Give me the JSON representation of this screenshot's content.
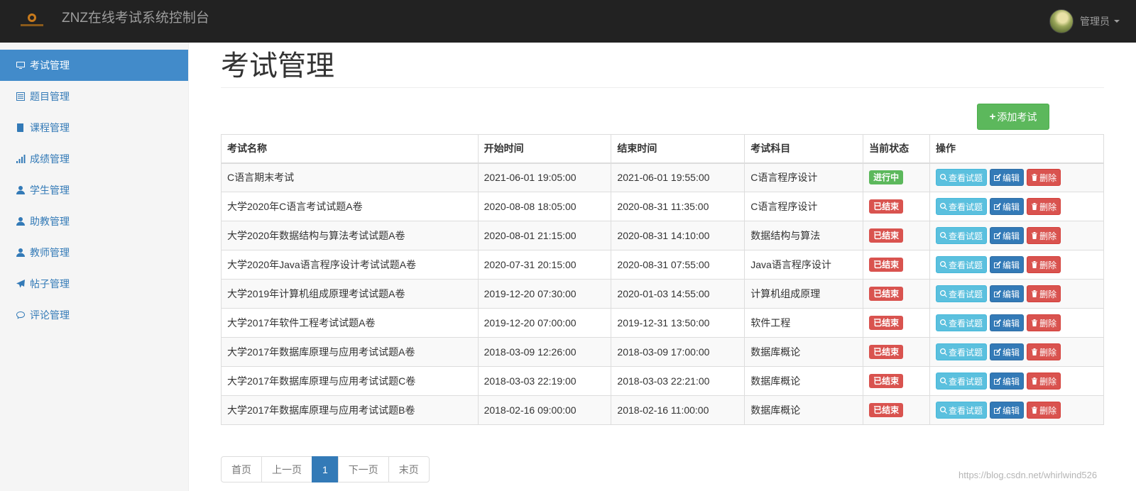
{
  "header": {
    "title": "ZNZ在线考试系统控制台",
    "user_name": "管理员"
  },
  "sidebar": {
    "items": [
      {
        "label": "考试管理",
        "icon": "monitor-icon",
        "active": true
      },
      {
        "label": "题目管理",
        "icon": "list-icon"
      },
      {
        "label": "课程管理",
        "icon": "book-icon"
      },
      {
        "label": "成绩管理",
        "icon": "signal-icon"
      },
      {
        "label": "学生管理",
        "icon": "user-icon"
      },
      {
        "label": "助教管理",
        "icon": "user-icon"
      },
      {
        "label": "教师管理",
        "icon": "user-icon"
      },
      {
        "label": "帖子管理",
        "icon": "send-icon"
      },
      {
        "label": "评论管理",
        "icon": "comment-icon"
      }
    ]
  },
  "main": {
    "title": "考试管理",
    "add_button": "添加考试",
    "table": {
      "headers": [
        "考试名称",
        "开始时间",
        "结束时间",
        "考试科目",
        "当前状态",
        "操作"
      ],
      "rows": [
        {
          "name": "C语言期末考试",
          "start": "2021-06-01 19:05:00",
          "end": "2021-06-01 19:55:00",
          "subject": "C语言程序设计",
          "status": "进行中"
        },
        {
          "name": "大学2020年C语言考试试题A卷",
          "start": "2020-08-08 18:05:00",
          "end": "2020-08-31 11:35:00",
          "subject": "C语言程序设计",
          "status": "已结束"
        },
        {
          "name": "大学2020年数据结构与算法考试试题A卷",
          "start": "2020-08-01 21:15:00",
          "end": "2020-08-31 14:10:00",
          "subject": "数据结构与算法",
          "status": "已结束"
        },
        {
          "name": "大学2020年Java语言程序设计考试试题A卷",
          "start": "2020-07-31 20:15:00",
          "end": "2020-08-31 07:55:00",
          "subject": "Java语言程序设计",
          "status": "已结束"
        },
        {
          "name": "大学2019年计算机组成原理考试试题A卷",
          "start": "2019-12-20 07:30:00",
          "end": "2020-01-03 14:55:00",
          "subject": "计算机组成原理",
          "status": "已结束"
        },
        {
          "name": "大学2017年软件工程考试试题A卷",
          "start": "2019-12-20 07:00:00",
          "end": "2019-12-31 13:50:00",
          "subject": "软件工程",
          "status": "已结束"
        },
        {
          "name": "大学2017年数据库原理与应用考试试题A卷",
          "start": "2018-03-09 12:26:00",
          "end": "2018-03-09 17:00:00",
          "subject": "数据库概论",
          "status": "已结束"
        },
        {
          "name": "大学2017年数据库原理与应用考试试题C卷",
          "start": "2018-03-03 22:19:00",
          "end": "2018-03-03 22:21:00",
          "subject": "数据库概论",
          "status": "已结束"
        },
        {
          "name": "大学2017年数据库原理与应用考试试题B卷",
          "start": "2018-02-16 09:00:00",
          "end": "2018-02-16 11:00:00",
          "subject": "数据库概论",
          "status": "已结束"
        }
      ],
      "actions": {
        "view": "查看试题",
        "edit": "编辑",
        "delete": "删除"
      }
    },
    "pagination": {
      "first": "首页",
      "prev": "上一页",
      "current": "1",
      "next": "下一页",
      "last": "末页"
    }
  },
  "watermark": "https://blog.csdn.net/whirlwind526",
  "colors": {
    "navbar": "#222222",
    "active": "#428bca",
    "success": "#5cb85c",
    "danger": "#d9534f",
    "info": "#5bc0de",
    "primary": "#337ab7"
  }
}
